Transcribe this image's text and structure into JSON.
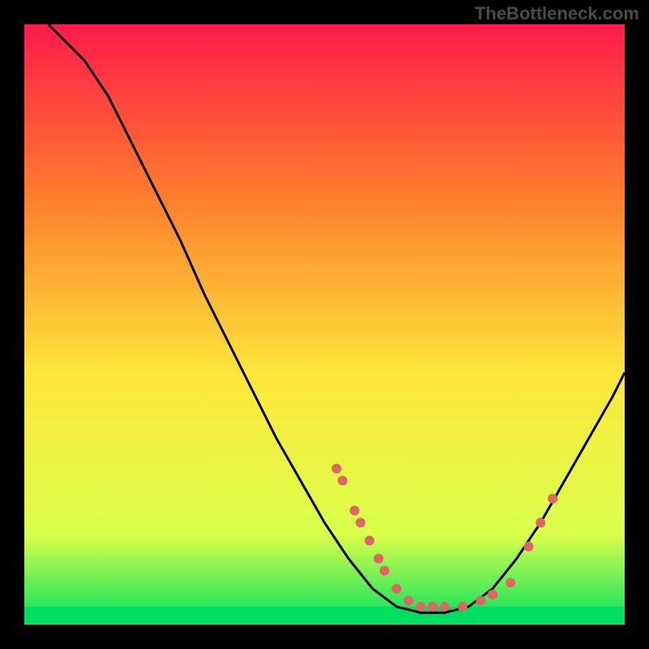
{
  "watermark": "TheBottleneck.com",
  "chart_data": {
    "type": "line",
    "title": "",
    "xlabel": "",
    "ylabel": "",
    "xlim": [
      0,
      100
    ],
    "ylim": [
      0,
      100
    ],
    "background_gradient": {
      "top": "#ff1a4a",
      "upper_mid": "#ff7a2e",
      "mid": "#ffe63a",
      "lower": "#d9ff4a",
      "bottom": "#00e060"
    },
    "curve": [
      {
        "x": 4,
        "y": 100
      },
      {
        "x": 6,
        "y": 98
      },
      {
        "x": 10,
        "y": 94
      },
      {
        "x": 14,
        "y": 88
      },
      {
        "x": 18,
        "y": 80
      },
      {
        "x": 22,
        "y": 72
      },
      {
        "x": 26,
        "y": 64
      },
      {
        "x": 30,
        "y": 55
      },
      {
        "x": 34,
        "y": 47
      },
      {
        "x": 38,
        "y": 39
      },
      {
        "x": 42,
        "y": 31
      },
      {
        "x": 46,
        "y": 24
      },
      {
        "x": 50,
        "y": 17
      },
      {
        "x": 54,
        "y": 11
      },
      {
        "x": 58,
        "y": 6
      },
      {
        "x": 62,
        "y": 3
      },
      {
        "x": 66,
        "y": 2
      },
      {
        "x": 70,
        "y": 2
      },
      {
        "x": 74,
        "y": 3
      },
      {
        "x": 78,
        "y": 6
      },
      {
        "x": 82,
        "y": 11
      },
      {
        "x": 86,
        "y": 17
      },
      {
        "x": 90,
        "y": 24
      },
      {
        "x": 94,
        "y": 31
      },
      {
        "x": 98,
        "y": 38
      },
      {
        "x": 100,
        "y": 42
      }
    ],
    "markers": [
      {
        "x": 52,
        "y": 26
      },
      {
        "x": 53,
        "y": 24
      },
      {
        "x": 55,
        "y": 19
      },
      {
        "x": 56,
        "y": 17
      },
      {
        "x": 57.5,
        "y": 14
      },
      {
        "x": 59,
        "y": 11
      },
      {
        "x": 60,
        "y": 9
      },
      {
        "x": 62,
        "y": 6
      },
      {
        "x": 64,
        "y": 4
      },
      {
        "x": 66,
        "y": 3
      },
      {
        "x": 68,
        "y": 3
      },
      {
        "x": 70,
        "y": 3
      },
      {
        "x": 73,
        "y": 3
      },
      {
        "x": 76,
        "y": 4
      },
      {
        "x": 78,
        "y": 5
      },
      {
        "x": 81,
        "y": 7
      },
      {
        "x": 84,
        "y": 13
      },
      {
        "x": 86,
        "y": 17
      },
      {
        "x": 88,
        "y": 21
      }
    ],
    "marker_color": "#e06666",
    "curve_color": "#000000",
    "green_band_y": 2
  }
}
